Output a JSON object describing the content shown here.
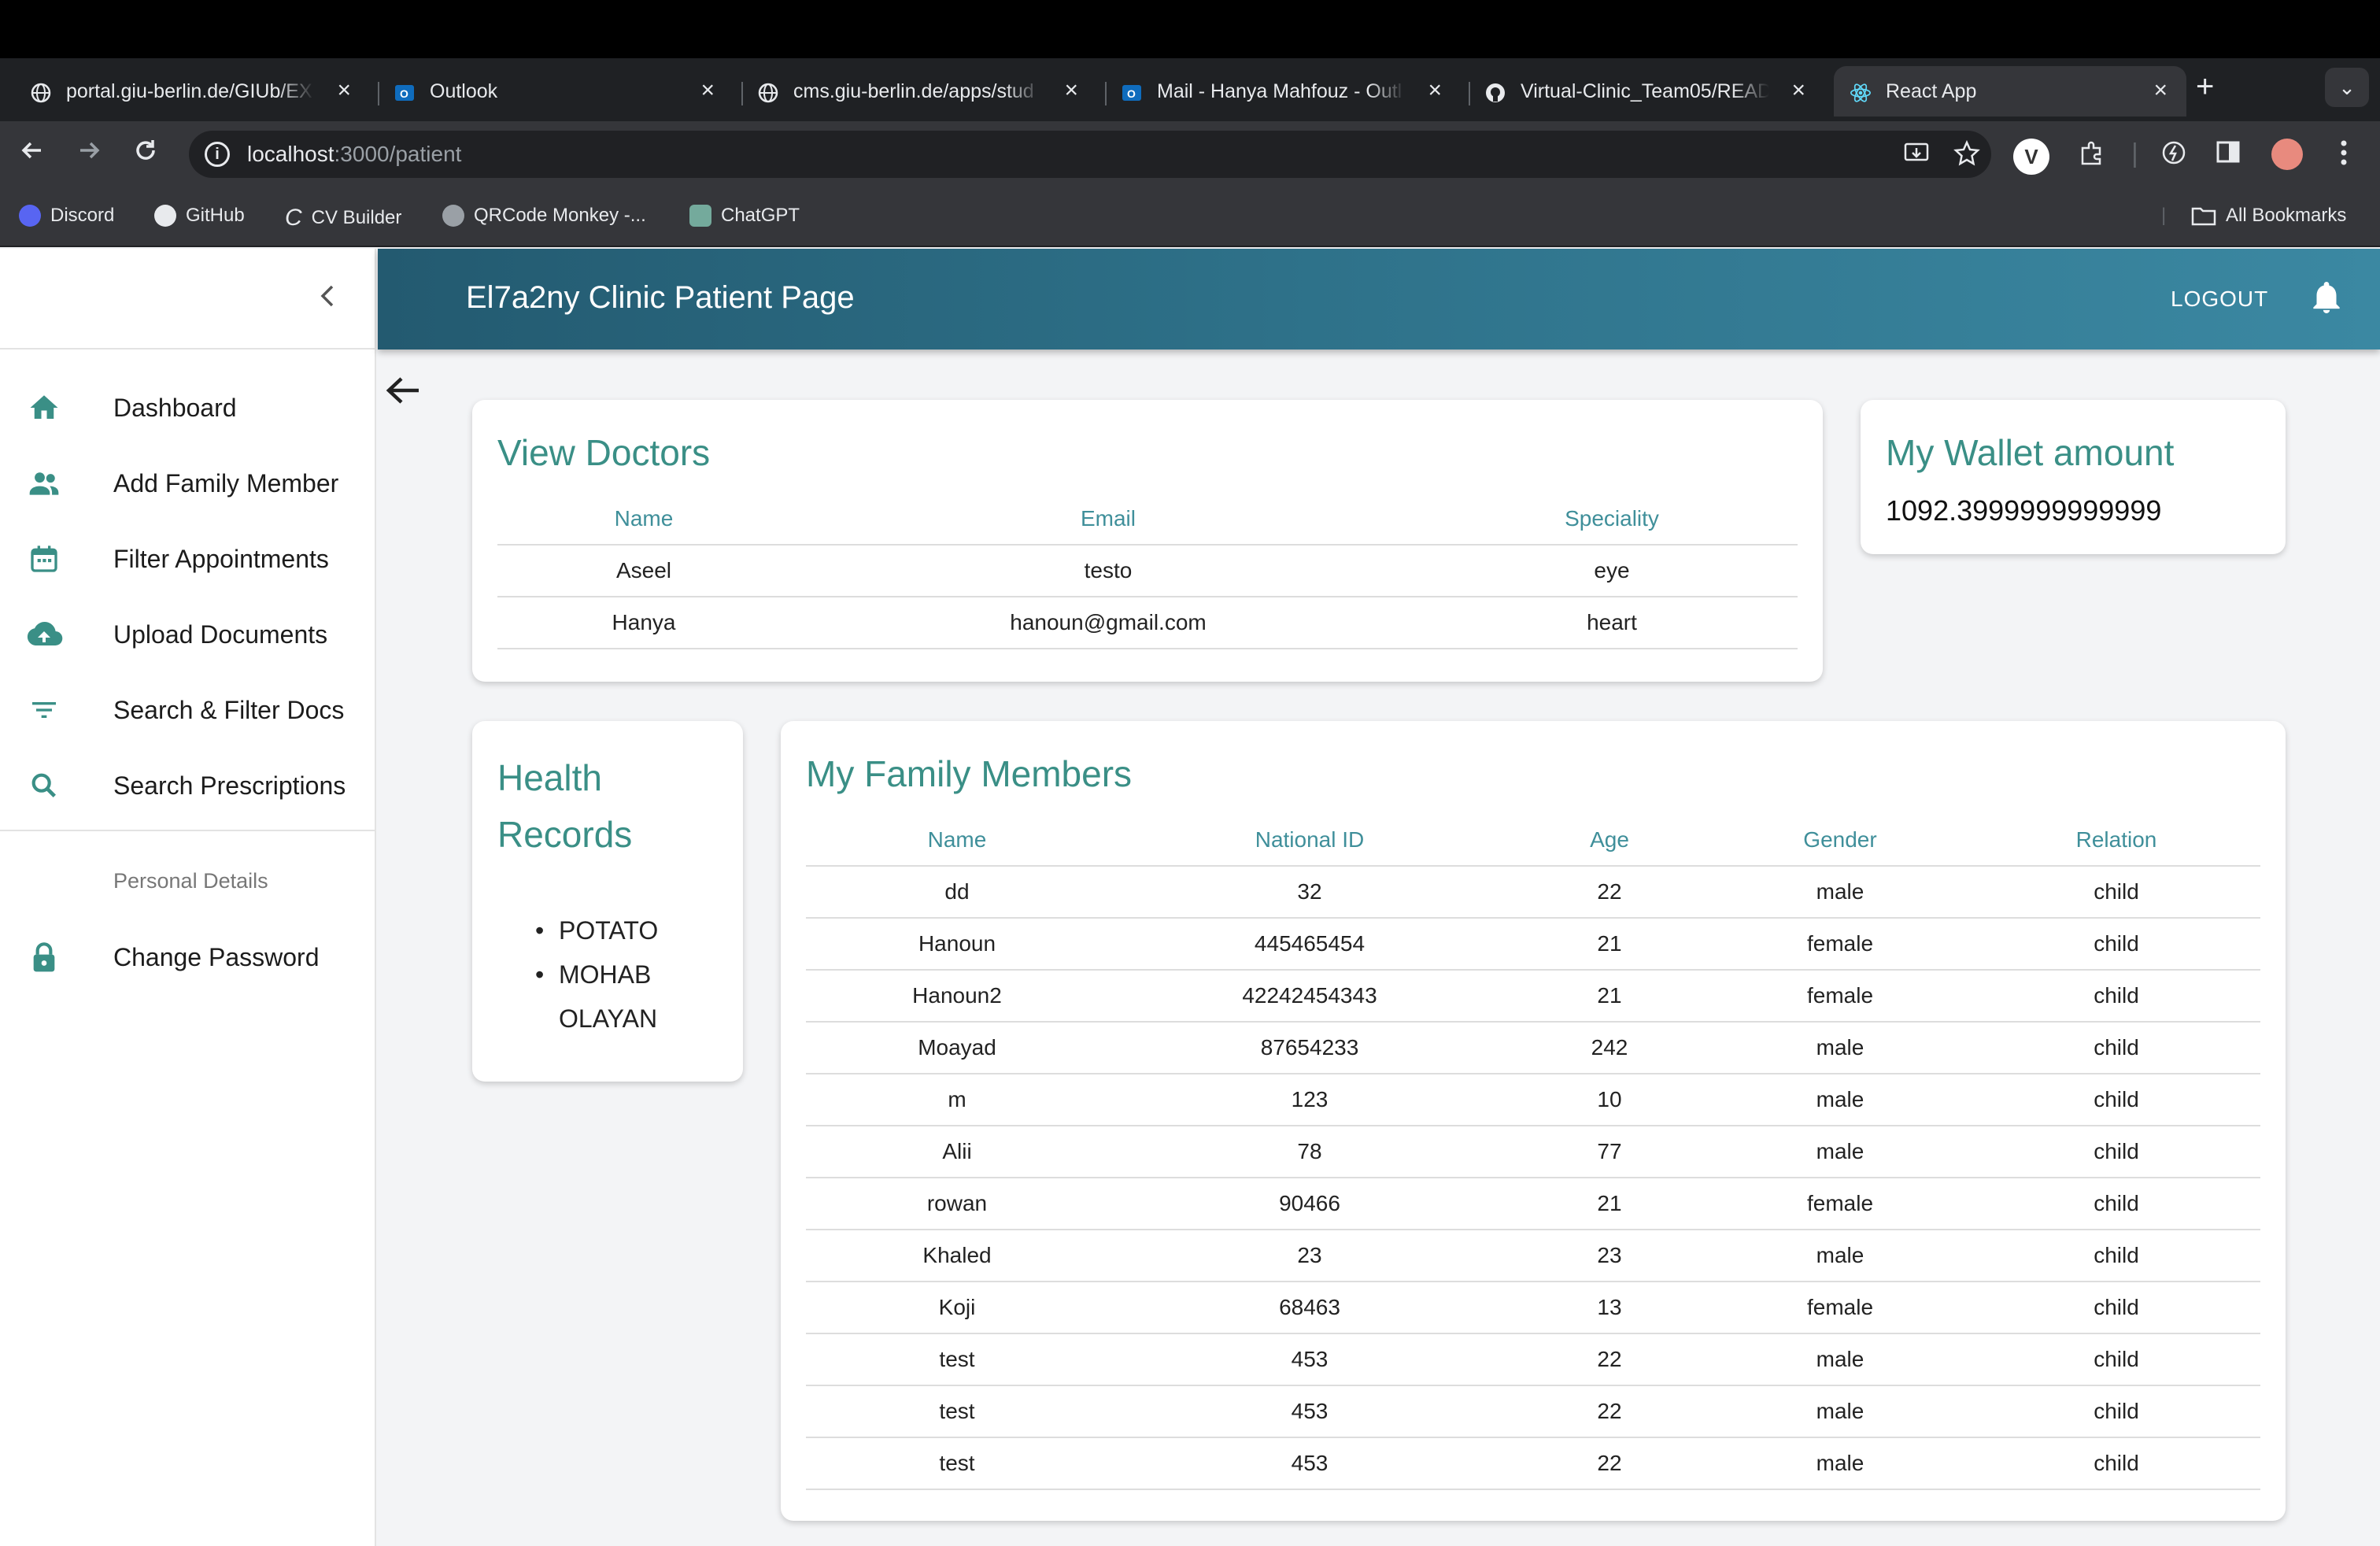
{
  "browser": {
    "tabs": [
      {
        "title": "portal.giu-berlin.de/GIUb/EX",
        "icon": "globe-icon"
      },
      {
        "title": "Outlook",
        "icon": "outlook-icon"
      },
      {
        "title": "cms.giu-berlin.de/apps/stud",
        "icon": "globe-icon"
      },
      {
        "title": "Mail - Hanya Mahfouz - Outl",
        "icon": "outlook-icon"
      },
      {
        "title": "Virtual-Clinic_Team05/READ",
        "icon": "github-icon"
      },
      {
        "title": "React App",
        "icon": "react-icon"
      }
    ],
    "url_host": "localhost",
    "url_path": ":3000/patient",
    "bookmarks": [
      "Discord",
      "GitHub",
      "CV Builder",
      "QRCode Monkey -...",
      "ChatGPT"
    ],
    "all_bookmarks": "All Bookmarks"
  },
  "header": {
    "title": "El7a2ny Clinic Patient Page",
    "logout": "LOGOUT"
  },
  "sidebar": {
    "items": [
      {
        "label": "Dashboard",
        "icon": "home-icon"
      },
      {
        "label": "Add Family Member",
        "icon": "people-icon"
      },
      {
        "label": "Filter Appointments",
        "icon": "calendar-icon"
      },
      {
        "label": "Upload Documents",
        "icon": "cloud-upload-icon"
      },
      {
        "label": "Search & Filter Docs",
        "icon": "filter-icon"
      },
      {
        "label": "Search Prescriptions",
        "icon": "search-icon"
      }
    ],
    "section": "Personal Details",
    "personal": [
      {
        "label": "Change Password",
        "icon": "lock-icon"
      }
    ]
  },
  "doctors": {
    "title": "View Doctors",
    "columns": [
      "Name",
      "Email",
      "Speciality"
    ],
    "rows": [
      [
        "Aseel",
        "testo",
        "eye"
      ],
      [
        "Hanya",
        "hanoun@gmail.com",
        "heart"
      ]
    ]
  },
  "wallet": {
    "title": "My Wallet amount",
    "amount": "1092.3999999999999"
  },
  "health_records": {
    "title_line1": "Health",
    "title_line2": "Records",
    "items": [
      "POTATO",
      "MOHAB OLAYAN"
    ]
  },
  "family": {
    "title": "My Family Members",
    "columns": [
      "Name",
      "National ID",
      "Age",
      "Gender",
      "Relation"
    ],
    "rows": [
      [
        "dd",
        "32",
        "22",
        "male",
        "child"
      ],
      [
        "Hanoun",
        "445465454",
        "21",
        "female",
        "child"
      ],
      [
        "Hanoun2",
        "42242454343",
        "21",
        "female",
        "child"
      ],
      [
        "Moayad",
        "87654233",
        "242",
        "male",
        "child"
      ],
      [
        "m",
        "123",
        "10",
        "male",
        "child"
      ],
      [
        "Alii",
        "78",
        "77",
        "male",
        "child"
      ],
      [
        "rowan",
        "90466",
        "21",
        "female",
        "child"
      ],
      [
        "Khaled",
        "23",
        "23",
        "male",
        "child"
      ],
      [
        "Koji",
        "68463",
        "13",
        "female",
        "child"
      ],
      [
        "test",
        "453",
        "22",
        "male",
        "child"
      ],
      [
        "test",
        "453",
        "22",
        "male",
        "child"
      ],
      [
        "test",
        "453",
        "22",
        "male",
        "child"
      ]
    ]
  },
  "colors": {
    "accent": "#3a8f86",
    "header_start": "#235a70",
    "header_end": "#3b88a2"
  }
}
